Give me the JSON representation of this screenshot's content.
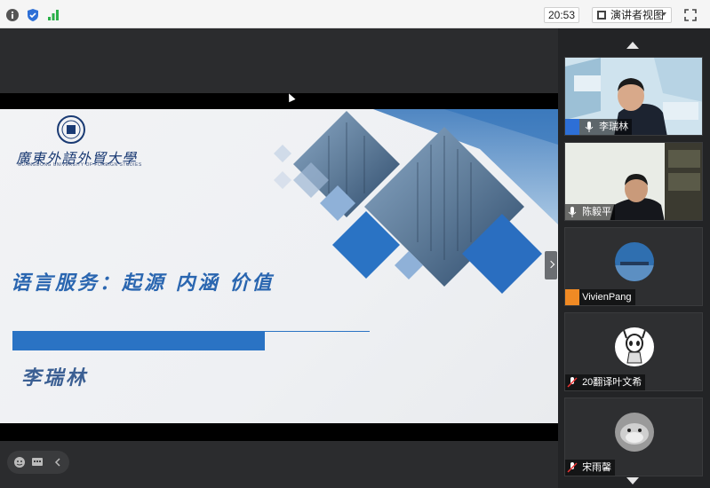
{
  "topbar": {
    "time": "20:53",
    "view_label": "演讲者视图"
  },
  "slide": {
    "university_name_cn": "廣東外語外貿大學",
    "university_name_en": "GUANGDONG UNIVERSITY OF FOREIGN STUDIES",
    "title": "语言服务：起源  内涵  价值",
    "presenter": "李瑞林"
  },
  "participants": [
    {
      "name": "李瑞林",
      "type": "video"
    },
    {
      "name": "陈毅平",
      "type": "video"
    },
    {
      "name": "VivienPang",
      "type": "avatar"
    },
    {
      "name": "20翻译叶文希",
      "type": "avatar"
    },
    {
      "name": "宋雨馨",
      "type": "avatar"
    }
  ],
  "colors": {
    "accent_blue": "#2a73c4",
    "title_blue": "#2a66b0",
    "panel_bg": "#232426"
  },
  "icons": [
    "info-icon",
    "shield-icon",
    "signal-icon",
    "fullscreen-icon",
    "emoji-icon",
    "chat-icon",
    "collapse-icon",
    "mic-icon",
    "user-icon"
  ]
}
